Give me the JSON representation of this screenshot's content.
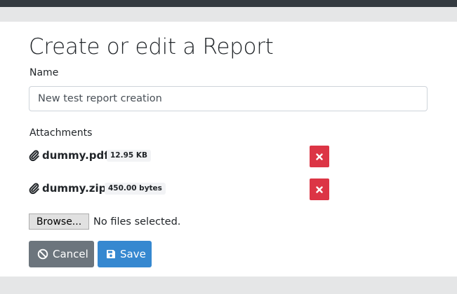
{
  "form": {
    "title": "Create or edit a Report",
    "name_label": "Name",
    "name_value": "New test report creation",
    "attachments_label": "Attachments"
  },
  "attachments": [
    {
      "file_name": "dummy.pdf",
      "size": "12.95 KB",
      "icon": "paperclip-icon",
      "remove_icon": "times-icon"
    },
    {
      "file_name": "dummy.zip",
      "size": "450.00 bytes",
      "icon": "paperclip-icon",
      "remove_icon": "times-icon"
    }
  ],
  "file_input": {
    "button_label": "Browse...",
    "status": "No files selected."
  },
  "actions": {
    "cancel_label": "Cancel",
    "cancel_icon": "ban-icon",
    "save_label": "Save",
    "save_icon": "floppy-disk-icon"
  },
  "colors": {
    "topbar": "#343a40",
    "danger": "#dc3545",
    "secondary": "#6c757d",
    "primary": "#3688d0"
  }
}
